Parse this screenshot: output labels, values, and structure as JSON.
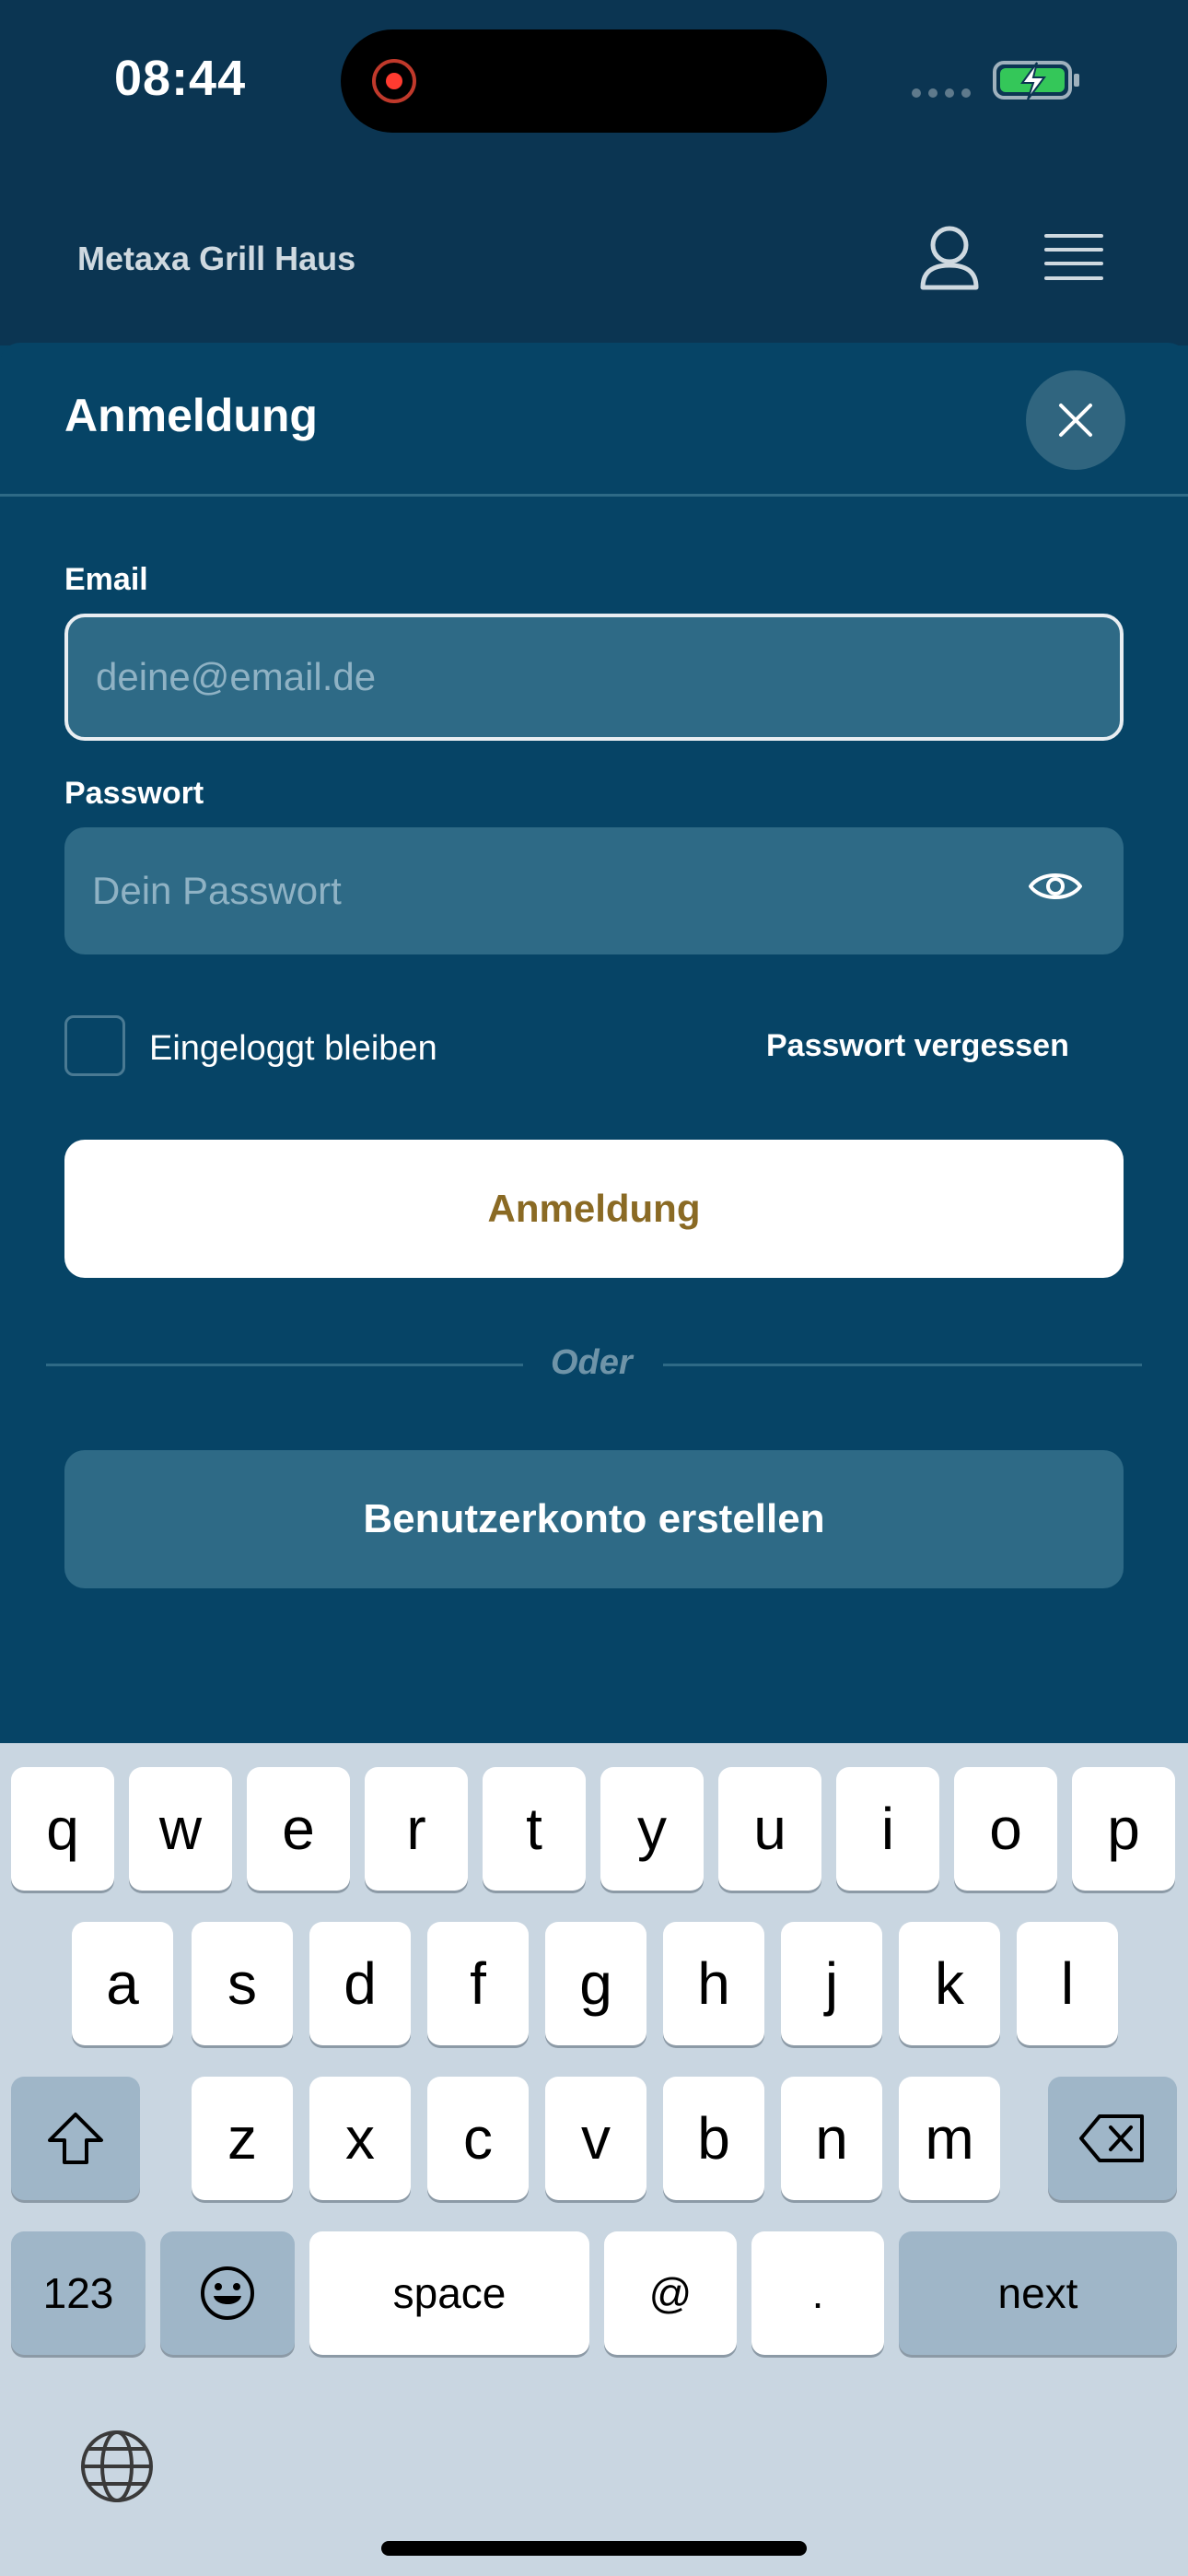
{
  "status_bar": {
    "time": "08:44"
  },
  "header": {
    "brand": "Metaxa Grill Haus"
  },
  "modal": {
    "title": "Anmeldung",
    "email_label": "Email",
    "email_placeholder": "deine@email.de",
    "password_label": "Passwort",
    "password_placeholder": "Dein Passwort",
    "remember_label": "Eingeloggt bleiben",
    "forgot_label": "Passwort vergessen",
    "login_button": "Anmeldung",
    "or_text": "Oder",
    "create_button": "Benutzerkonto erstellen"
  },
  "keyboard": {
    "row1": [
      "q",
      "w",
      "e",
      "r",
      "t",
      "y",
      "u",
      "i",
      "o",
      "p"
    ],
    "row2": [
      "a",
      "s",
      "d",
      "f",
      "g",
      "h",
      "j",
      "k",
      "l"
    ],
    "row3": [
      "z",
      "x",
      "c",
      "v",
      "b",
      "n",
      "m"
    ],
    "numbers_key": "123",
    "space_key": "space",
    "at_key": "@",
    "dot_key": ".",
    "next_key": "next"
  },
  "colors": {
    "background": "#064466",
    "header": "#0b3552",
    "field": "#2e6a86",
    "login_text": "#8a6a24",
    "keyboard": "#c9d6e1"
  }
}
